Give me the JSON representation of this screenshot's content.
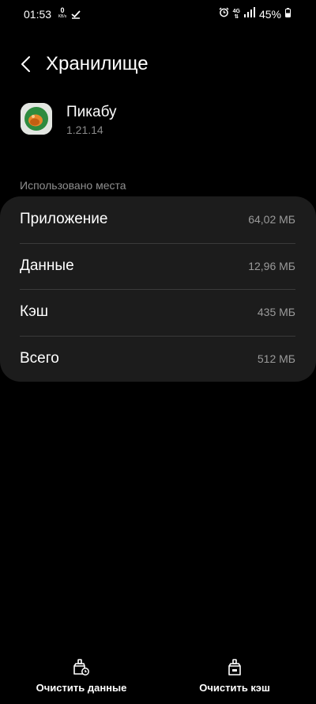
{
  "status_bar": {
    "time": "01:53",
    "speed_value": "0",
    "speed_unit": "KB/s",
    "network": "4G",
    "battery": "45%"
  },
  "header": {
    "title": "Хранилище"
  },
  "app": {
    "name": "Пикабу",
    "version": "1.21.14"
  },
  "storage": {
    "section_label": "Использовано места",
    "rows": [
      {
        "label": "Приложение",
        "value": "64,02 МБ"
      },
      {
        "label": "Данные",
        "value": "12,96 МБ"
      },
      {
        "label": "Кэш",
        "value": "435 МБ"
      },
      {
        "label": "Всего",
        "value": "512 МБ"
      }
    ]
  },
  "actions": {
    "clear_data": "Очистить данные",
    "clear_cache": "Очистить кэш"
  },
  "colors": {
    "background": "#000000",
    "card": "#1c1c1c",
    "secondary_text": "#8f8f8f",
    "app_icon_green": "#2e8b3e",
    "app_icon_orange": "#e8862a"
  }
}
